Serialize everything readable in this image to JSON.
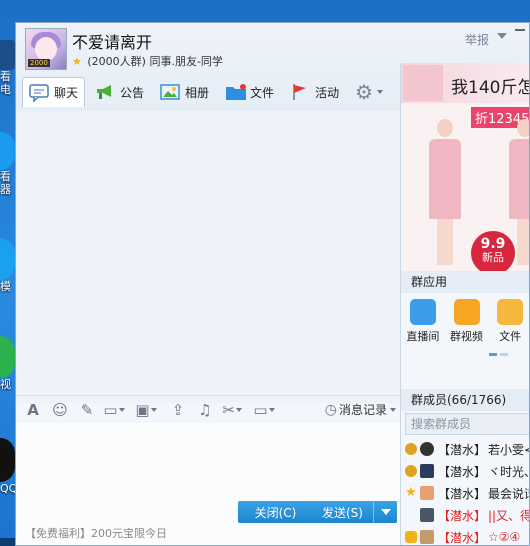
{
  "desktop": {
    "icons": [
      {
        "label": "看",
        "sub": "电"
      },
      {
        "label": "看",
        "sub": "器"
      },
      {
        "label": "模",
        "sub": ""
      },
      {
        "label": "视",
        "sub": ""
      },
      {
        "label": "QQ",
        "sub": ""
      }
    ]
  },
  "window": {
    "group_name": "不爱请离开",
    "member_count_text": "(2000人群)",
    "group_tags": "同事.朋友-同学",
    "report_label": "举报",
    "avatar_badge": "2000"
  },
  "tabs": [
    {
      "label": "聊天",
      "icon": "chat-bubble-icon"
    },
    {
      "label": "公告",
      "icon": "megaphone-icon"
    },
    {
      "label": "相册",
      "icon": "album-icon"
    },
    {
      "label": "文件",
      "icon": "folder-icon"
    },
    {
      "label": "活动",
      "icon": "flag-icon"
    }
  ],
  "toolbar": {
    "history_label": "消息记录"
  },
  "input_area": {
    "promo_text": "【免费福利】200元宝限今日"
  },
  "buttons": {
    "close_label": "关闭(C)",
    "send_label": "发送(S)"
  },
  "ad": {
    "headline": "我140斤怎",
    "price": "折12345",
    "tag_top": "9.9",
    "tag_bottom": "新品"
  },
  "group_apps": {
    "title": "群应用",
    "items": [
      {
        "label": "直播间",
        "icon": "live-room-icon"
      },
      {
        "label": "群视频",
        "icon": "group-video-icon"
      },
      {
        "label": "文件",
        "icon": "file-icon"
      }
    ]
  },
  "members_panel": {
    "title": "群成员(66/1766)",
    "search_placeholder": "搜索群成员",
    "members": [
      {
        "role": "【潜水】",
        "name": "若小雯<"
      },
      {
        "role": "【潜水】",
        "name": "ヾ时光、"
      },
      {
        "role": "【潜水】",
        "name": "最会说话"
      },
      {
        "role": "【潜水】",
        "name": "||又、得"
      },
      {
        "role": "【潜水】",
        "name": "☆②④"
      },
      {
        "role": "【潜水】",
        "name": ""
      }
    ]
  },
  "colors": {
    "accent": "#1c85cf",
    "window_bg": "#f3f6fa",
    "red_name": "#e02222"
  }
}
